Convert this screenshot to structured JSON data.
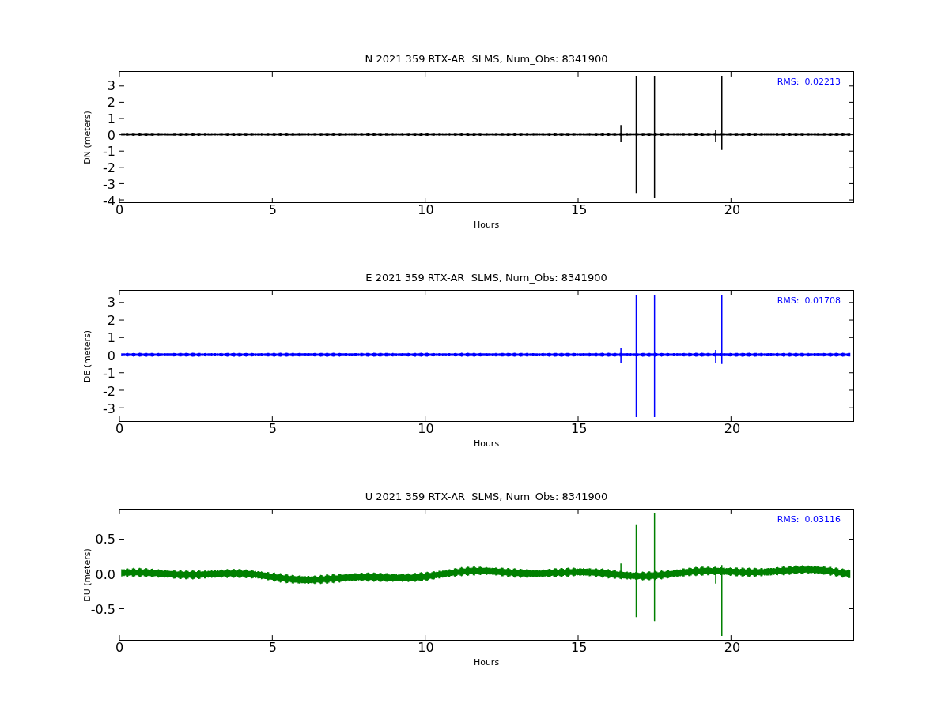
{
  "panels": [
    {
      "title": "N 2021 359 RTX-AR  SLMS, Num_Obs: 8341900",
      "ylabel": "DN (meters)",
      "xlabel": "Hours",
      "rms": "RMS:  0.02213",
      "color": "#000000",
      "yticks": [
        "3",
        "2",
        "1",
        "0",
        "-1",
        "-2",
        "-3",
        "-4"
      ],
      "xticks": [
        "0",
        "5",
        "10",
        "15",
        "20"
      ]
    },
    {
      "title": "E 2021 359 RTX-AR  SLMS, Num_Obs: 8341900",
      "ylabel": "DE (meters)",
      "xlabel": "Hours",
      "rms": "RMS:  0.01708",
      "color": "#0000ff",
      "yticks": [
        "3",
        "2",
        "1",
        "0",
        "-1",
        "-2",
        "-3"
      ],
      "xticks": [
        "0",
        "5",
        "10",
        "15",
        "20"
      ]
    },
    {
      "title": "U 2021 359 RTX-AR  SLMS, Num_Obs: 8341900",
      "ylabel": "DU (meters)",
      "xlabel": "Hours",
      "rms": "RMS:  0.03116",
      "color": "#008000",
      "yticks": [
        "0.5",
        "0.0",
        "-0.5"
      ],
      "xticks": [
        "0",
        "5",
        "10",
        "15",
        "20"
      ]
    }
  ]
}
